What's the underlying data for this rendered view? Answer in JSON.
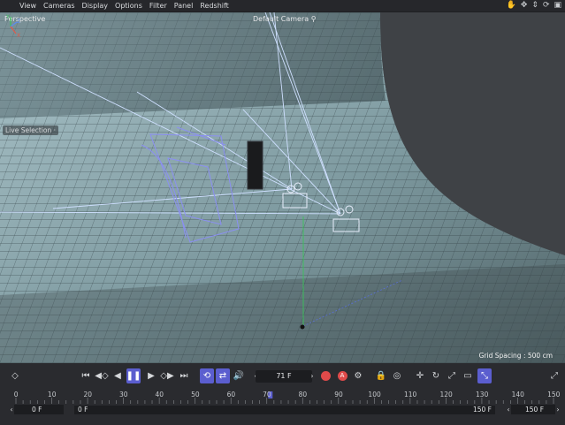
{
  "menu": [
    "View",
    "Cameras",
    "Display",
    "Options",
    "Filter",
    "Panel",
    "Redshift"
  ],
  "viewport": {
    "label": "Perspective",
    "camera": "Default Camera",
    "mode": "Live Selection",
    "mode_suffix": "·",
    "grid_spacing": "Grid Spacing : 500 cm",
    "axes": {
      "y": "Y",
      "z": "Z",
      "x": "X"
    }
  },
  "transport": {
    "frame": "71 F",
    "record_letter": "A"
  },
  "ruler": {
    "ticks": [
      "0",
      "10",
      "20",
      "30",
      "40",
      "50",
      "60",
      "70",
      "80",
      "90",
      "100",
      "110",
      "120",
      "130",
      "140",
      "150"
    ],
    "current_frame": 71,
    "max_frame": 150
  },
  "range": {
    "start": "0 F",
    "min": "0 F",
    "max": "150 F",
    "end": "150 F"
  }
}
